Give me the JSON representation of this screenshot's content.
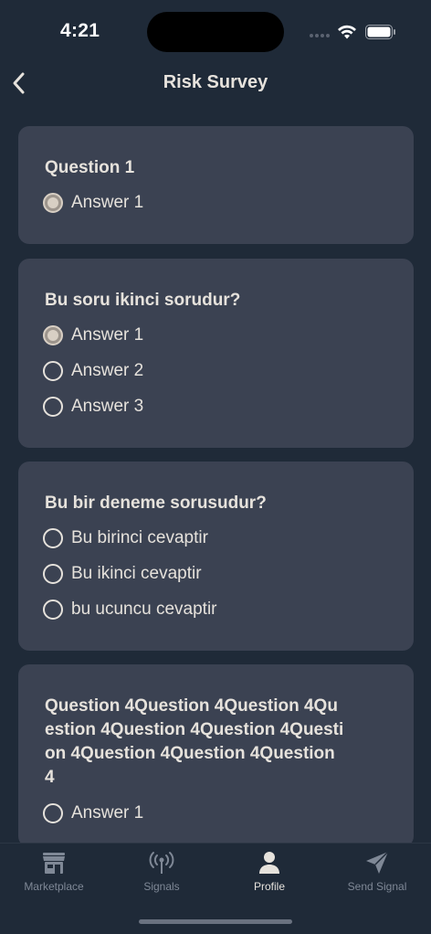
{
  "status_bar": {
    "time": "4:21"
  },
  "nav": {
    "title": "Risk Survey"
  },
  "questions": [
    {
      "text": "Question 1",
      "options": [
        {
          "label": "Answer 1",
          "selected": true
        }
      ]
    },
    {
      "text": "Bu soru ikinci sorudur?",
      "options": [
        {
          "label": "Answer 1",
          "selected": true
        },
        {
          "label": "Answer 2",
          "selected": false
        },
        {
          "label": "Answer 3",
          "selected": false
        }
      ]
    },
    {
      "text": "Bu bir deneme sorusudur?",
      "options": [
        {
          "label": "Bu birinci cevaptir",
          "selected": false
        },
        {
          "label": "Bu ikinci cevaptir",
          "selected": false
        },
        {
          "label": "bu ucuncu cevaptir",
          "selected": false
        }
      ]
    },
    {
      "text": "Question 4Question 4Question 4Question 4Question 4Question 4Question 4Question 4Question 4Question 4",
      "options": [
        {
          "label": "Answer 1",
          "selected": false
        }
      ]
    }
  ],
  "tabs": [
    {
      "label": "Marketplace",
      "icon": "store-icon",
      "active": false
    },
    {
      "label": "Signals",
      "icon": "broadcast-icon",
      "active": false
    },
    {
      "label": "Profile",
      "icon": "person-icon",
      "active": true
    },
    {
      "label": "Send Signal",
      "icon": "paper-plane-icon",
      "active": false
    }
  ],
  "colors": {
    "background": "#1f2a38",
    "card": "#3b4252",
    "text": "#e6e2dc",
    "inactive_tab": "#7f8896"
  }
}
